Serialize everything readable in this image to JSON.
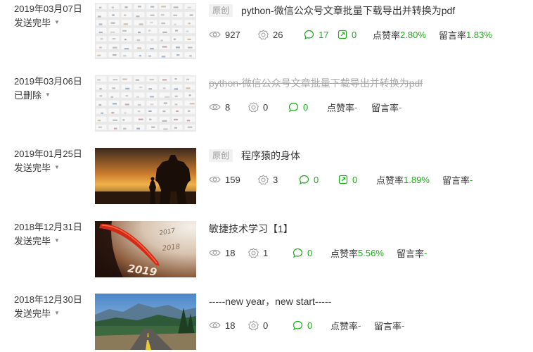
{
  "colors": {
    "accent": "#1aad19",
    "text": "#353535",
    "muted": "#a8a8a8",
    "tag_bg": "#f1f1f1"
  },
  "articles": [
    {
      "date": "2019年03月07日",
      "status": "发送完毕",
      "tag": "原创",
      "title": "python-微信公众号文章批量下载导出并转换为pdf",
      "views": "927",
      "likes": "26",
      "comments": "17",
      "shares": "0",
      "like_rate_label": "点赞率",
      "like_rate": "2.80%",
      "comment_rate_label": "留言率",
      "comment_rate": "1.83%",
      "thumb": "grid-screenshot"
    },
    {
      "date": "2019年03月06日",
      "status": "已删除",
      "title": "python-微信公众号文章批量下载导出并转换为pdf",
      "views": "8",
      "likes": "0",
      "comments": "0",
      "like_rate_label": "点赞率",
      "like_rate": "-",
      "comment_rate_label": "留言率",
      "comment_rate": "-",
      "thumb": "grid-screenshot"
    },
    {
      "date": "2019年01月25日",
      "status": "发送完毕",
      "tag": "原创",
      "title": "程序猿的身体",
      "views": "159",
      "likes": "3",
      "comments": "0",
      "shares": "0",
      "like_rate_label": "点赞率",
      "like_rate": "1.89%",
      "comment_rate_label": "留言率",
      "comment_rate": "-",
      "thumb": "robot-sunset"
    },
    {
      "date": "2018年12月31日",
      "status": "发送完毕",
      "title": "敏捷技术学习【1】",
      "views": "18",
      "likes": "1",
      "comments": "0",
      "like_rate_label": "点赞率",
      "like_rate": "5.56%",
      "comment_rate_label": "留言率",
      "comment_rate": "-",
      "thumb": "speedometer-2019",
      "thumb_texts": [
        "2017",
        "2018",
        "2019"
      ]
    },
    {
      "date": "2018年12月30日",
      "status": "发送完毕",
      "title": "-----new year，new start-----",
      "views": "18",
      "likes": "0",
      "comments": "0",
      "like_rate_label": "点赞率",
      "like_rate": "-",
      "comment_rate_label": "留言率",
      "comment_rate": "-",
      "thumb": "mountain-road"
    }
  ]
}
